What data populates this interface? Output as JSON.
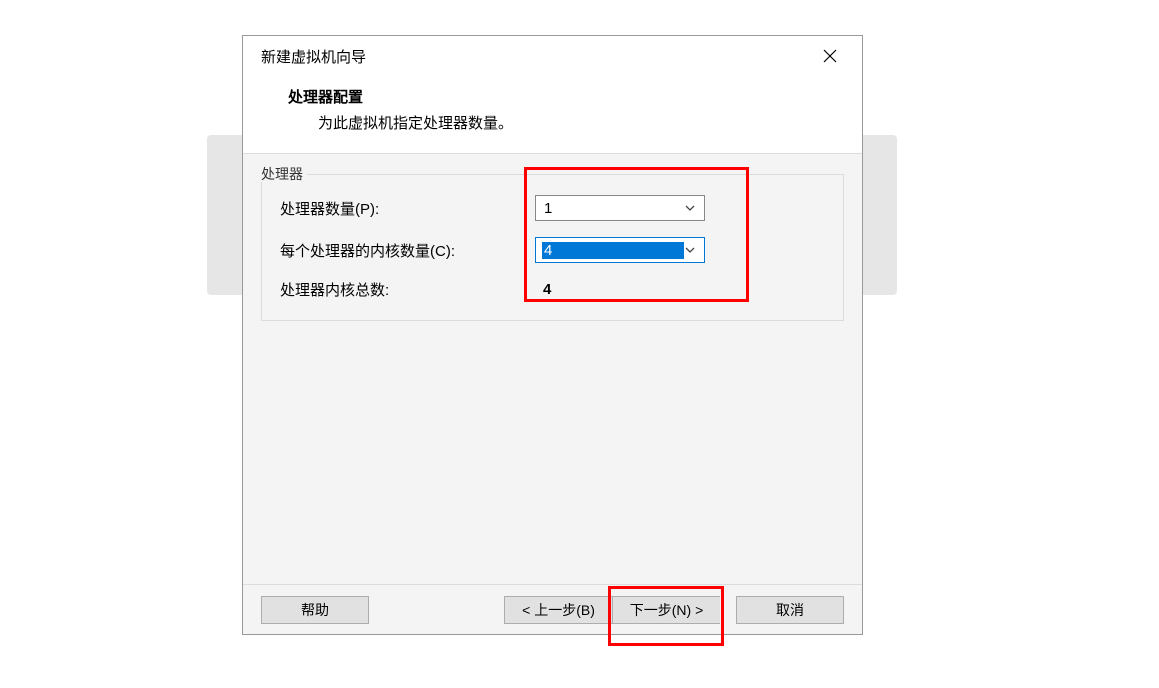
{
  "dialog": {
    "title": "新建虚拟机向导",
    "header_title": "处理器配置",
    "header_subtitle": "为此虚拟机指定处理器数量。"
  },
  "fieldset": {
    "legend": "处理器",
    "rows": {
      "processor_count": {
        "label": "处理器数量(P):",
        "value": "1"
      },
      "cores_per_processor": {
        "label": "每个处理器的内核数量(C):",
        "value": "4"
      },
      "total_cores": {
        "label": "处理器内核总数:",
        "value": "4"
      }
    }
  },
  "buttons": {
    "help": "帮助",
    "back": "< 上一步(B)",
    "next": "下一步(N) >",
    "cancel": "取消"
  }
}
